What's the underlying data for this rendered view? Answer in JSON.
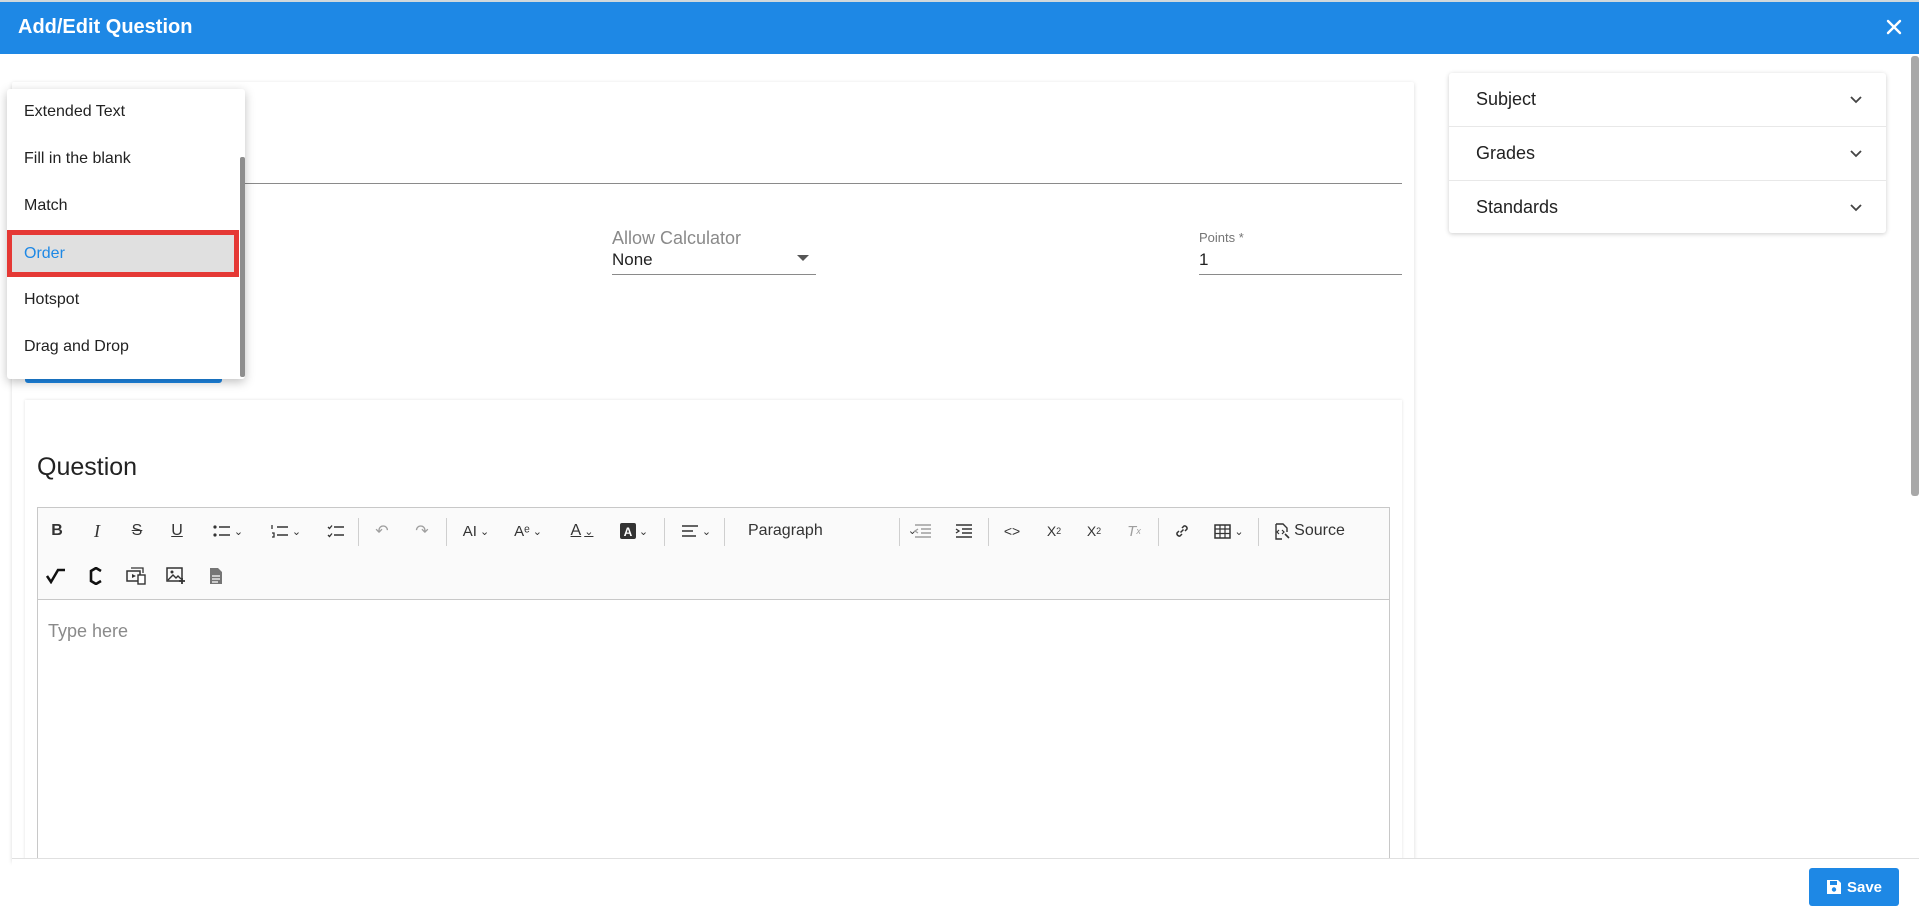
{
  "header": {
    "title": "Add/Edit Question"
  },
  "form": {
    "calculator_label": "Allow Calculator",
    "calculator_value": "None",
    "points_label": "Points *",
    "points_value": "1"
  },
  "question": {
    "heading": "Question",
    "placeholder": "Type here",
    "paragraph_select": "Paragraph",
    "source_label": "Source"
  },
  "dropdown": {
    "items": [
      "Extended Text",
      "Fill in the blank",
      "Match",
      "Order",
      "Hotspot",
      "Drag and Drop"
    ],
    "selected": "Order"
  },
  "side_panel": {
    "items": [
      "Subject",
      "Grades",
      "Standards"
    ]
  },
  "footer": {
    "save_label": "Save"
  },
  "colors": {
    "primary": "#1e88e5",
    "highlight_border": "#e53935",
    "selected_bg": "#e0e0e0"
  }
}
